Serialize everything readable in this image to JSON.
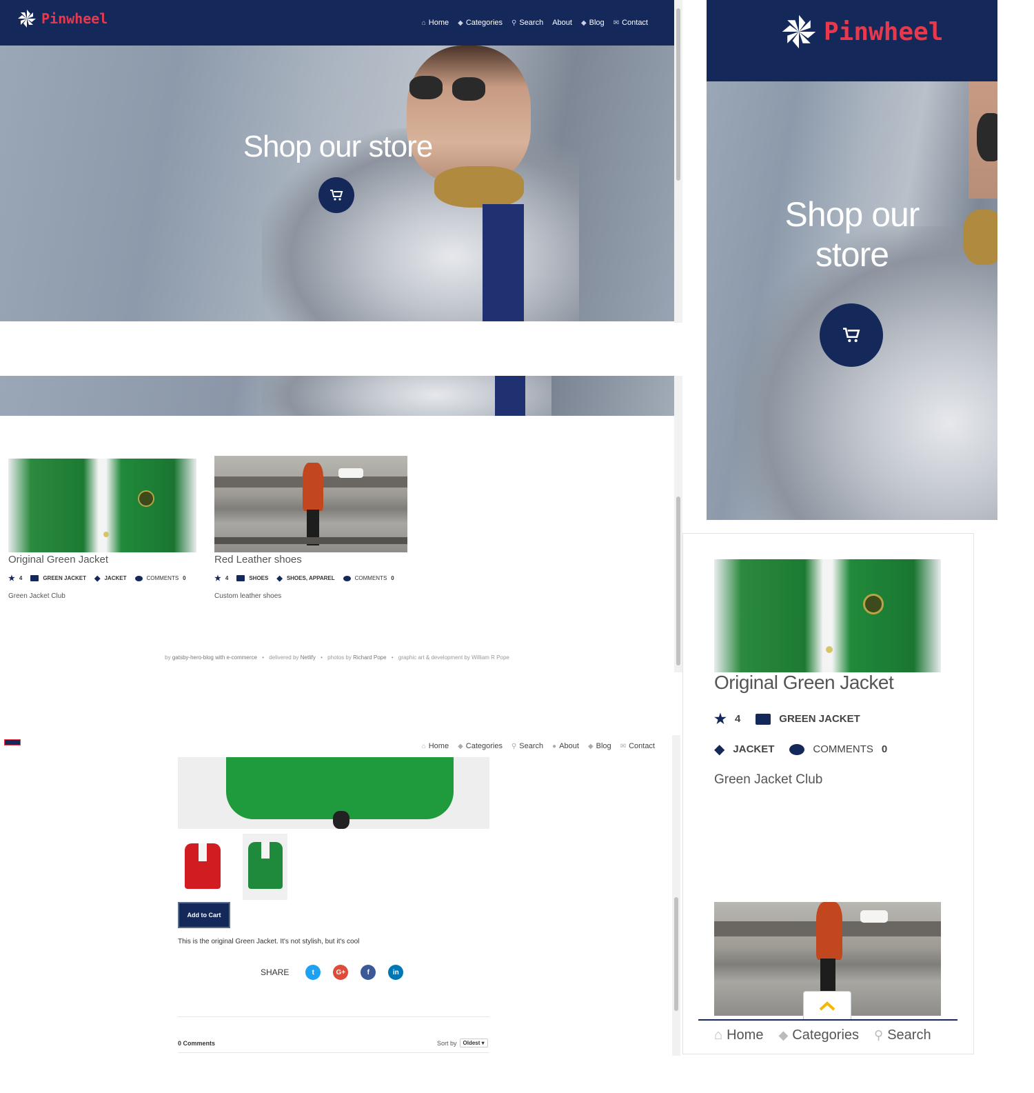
{
  "brand": {
    "name": "Pinwheel"
  },
  "nav": {
    "home": "Home",
    "categories": "Categories",
    "search": "Search",
    "about": "About",
    "blog": "Blog",
    "contact": "Contact"
  },
  "hero": {
    "title": "Shop our store",
    "title_line1": "Shop our",
    "title_line2": "store"
  },
  "products": [
    {
      "title": "Original Green Jacket",
      "rating": "4",
      "name_tag": "GREEN JACKET",
      "category": "JACKET",
      "comments_label": "COMMENTS",
      "comments_count": "0",
      "description": "Green Jacket Club"
    },
    {
      "title": "Red Leather shoes",
      "rating": "4",
      "name_tag": "SHOES",
      "category": "SHOES, APPAREL",
      "comments_label": "COMMENTS",
      "comments_count": "0",
      "description": "Custom leather shoes"
    }
  ],
  "footer": {
    "by_prefix": "by",
    "by_link": "gatsby-hero-blog with e-commerce",
    "delivered_prefix": "delivered by",
    "delivered_link": "Netlify",
    "photos_prefix": "photos by",
    "photos_link": "Richard Pope",
    "graphic_prefix": "graphic art & development by",
    "graphic_link": "William R Pope",
    "separator": "•"
  },
  "product_page": {
    "add_to_cart": "Add to Cart",
    "description": "This is the original Green Jacket. It's not stylish, but it's cool",
    "share_label": "SHARE",
    "comments_count_label": "0 Comments",
    "sort_label": "Sort by",
    "sort_value": "Oldest"
  },
  "mobile": {
    "rating": "4",
    "name_tag": "GREEN JACKET",
    "category": "JACKET",
    "comments_label": "COMMENTS",
    "comments_count": "0",
    "title": "Original Green Jacket",
    "description": "Green Jacket Club"
  },
  "colors": {
    "navy": "#14285a",
    "brand_red": "#e8394c",
    "accent_yellow": "#f5b800"
  },
  "icons": [
    "home-icon",
    "tag-icon",
    "search-icon",
    "user-icon",
    "mail-icon",
    "star-icon",
    "id-card-icon",
    "comment-icon",
    "cart-icon",
    "chevron-up-icon",
    "twitter-icon",
    "google-plus-icon",
    "facebook-icon",
    "linkedin-icon"
  ]
}
